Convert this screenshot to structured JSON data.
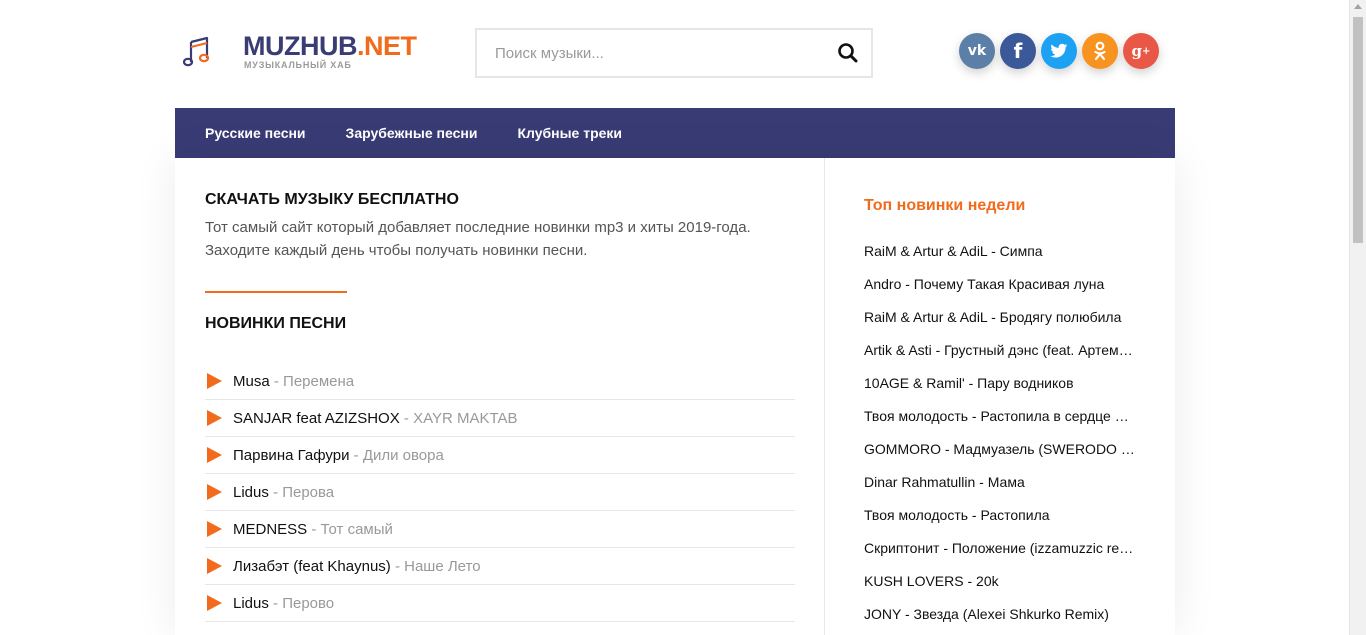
{
  "logo": {
    "name_part1": "MUZHUB",
    "name_part2": ".NET",
    "subtitle": "МУЗЫКАЛЬНЫЙ ХАБ"
  },
  "search": {
    "placeholder": "Поиск музыки..."
  },
  "social": [
    {
      "name": "vk",
      "glyph": "vk",
      "color": "#5b7fa6"
    },
    {
      "name": "facebook",
      "glyph": "f",
      "color": "#3b5998"
    },
    {
      "name": "twitter",
      "glyph": "t",
      "color": "#1da1f2"
    },
    {
      "name": "odnoklassniki",
      "glyph": "ok",
      "color": "#f7931e"
    },
    {
      "name": "google-plus",
      "glyph": "g+",
      "color": "#e95847"
    }
  ],
  "nav": [
    "Русские песни",
    "Зарубежные песни",
    "Клубные треки"
  ],
  "main": {
    "heading": "СКАЧАТЬ МУЗЫКУ БЕСПЛАТНО",
    "intro_line1": "Тот самый сайт который добавляет последние новинки mp3 и хиты 2019-года.",
    "intro_line2": "Заходите каждый день чтобы получать новинки песни.",
    "new_heading": "НОВИНКИ ПЕСНИ",
    "songs": [
      {
        "artist": "Musa",
        "title": "Перемена"
      },
      {
        "artist": "SANJAR feat AZIZSHOX",
        "title": "XAYR MAKTAB"
      },
      {
        "artist": "Парвина Гафури",
        "title": "Дили овора"
      },
      {
        "artist": "Lidus",
        "title": "Перова"
      },
      {
        "artist": "MEDNESS",
        "title": "Тот самый"
      },
      {
        "artist": "Лизабэт (feat Khaynus)",
        "title": "Наше Лето"
      },
      {
        "artist": "Lidus",
        "title": "Перово"
      }
    ]
  },
  "sidebar": {
    "title": "Топ новинки недели",
    "items": [
      "RaiM & Artur & AdiL - Симпа",
      "Andro - Почему Такая Красивая луна",
      "RaiM & Artur & AdiL - Бродягу полюбила",
      "Artik & Asti - Грустный дэнс (feat. Артем Качер)",
      "10AGE & Ramil' - Пару водников",
      "Твоя молодость - Растопила в сердце лёд",
      "GOMMORO - Мадмуазель (SWERODO Remix)",
      "Dinar Rahmatullin - Мама",
      "Твоя молодость - Растопила",
      "Скриптонит - Положение (izzamuzzic remix)",
      "KUSH LOVERS - 20k",
      "JONY - Звезда (Alexei Shkurko Remix)"
    ]
  },
  "colors": {
    "accent": "#f26a1b",
    "nav_bg": "#393b75"
  }
}
